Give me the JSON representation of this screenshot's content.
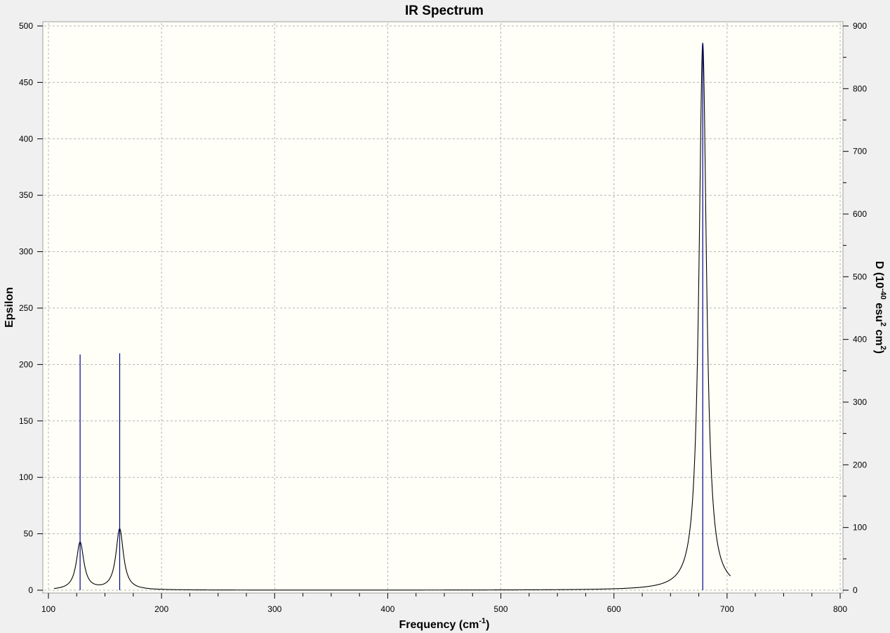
{
  "colors": {
    "window_background": "#f0f0f0",
    "plot_background": "#fffff8",
    "grid": "#b4b4b4",
    "spectrum_line": "#000000",
    "stick_lines": "#00008b"
  },
  "chart_data": {
    "type": "line",
    "title": "IR Spectrum",
    "xlabel": "Frequency (cm-1)",
    "xlabel_parts": {
      "base": "Frequency (cm",
      "sup": "-1",
      "tail": ")"
    },
    "ylabel_left": "Epsilon",
    "ylabel_right": "D (10-40 esu2 cm2)",
    "ylabel_right_parts": {
      "a": "D (10",
      "s1": "-40",
      "b": " esu",
      "s2": "2",
      "c": " cm",
      "s3": "2",
      "d": ")"
    },
    "xlim": [
      100,
      800
    ],
    "ylim_left": [
      0,
      500
    ],
    "ylim_right": [
      0,
      900
    ],
    "grid": true,
    "x_ticks": [
      "100",
      "200",
      "300",
      "400",
      "500",
      "600",
      "700",
      "800"
    ],
    "y_left_ticks": [
      "0",
      "50",
      "100",
      "150",
      "200",
      "250",
      "300",
      "350",
      "400",
      "450",
      "500"
    ],
    "y_right_ticks": [
      "0",
      "100",
      "200",
      "300",
      "400",
      "500",
      "600",
      "700",
      "800",
      "900"
    ],
    "x_range_curve": [
      105,
      703
    ],
    "series": [
      {
        "type": "line",
        "description": "Lorentzian-broadened absorption (Epsilon, left axis)",
        "peaks": [
          {
            "x": 128,
            "height": 42,
            "hwhm": 4
          },
          {
            "x": 163,
            "height": 54,
            "hwhm": 4
          },
          {
            "x": 678.5,
            "height": 485,
            "hwhm": 4
          }
        ]
      },
      {
        "type": "stick",
        "description": "Dipole strength D (right axis)",
        "x": [
          128,
          163,
          678.5
        ],
        "y": [
          376,
          378,
          872
        ]
      }
    ]
  }
}
